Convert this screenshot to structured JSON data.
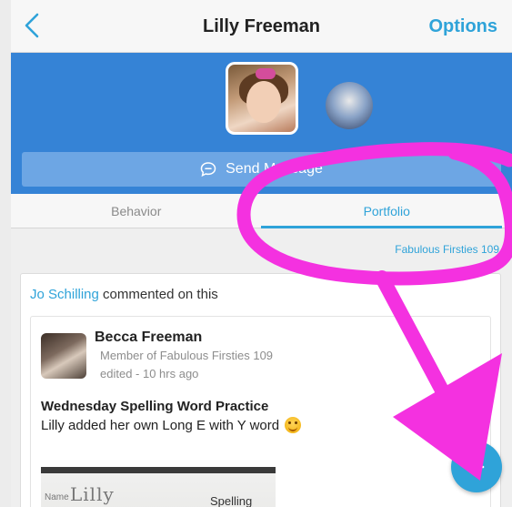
{
  "header": {
    "title": "Lilly Freeman",
    "options_label": "Options",
    "back_icon": "chevron-left-icon"
  },
  "profile": {
    "send_message_label": "Send Message"
  },
  "tabs": [
    {
      "label": "Behavior",
      "active": false
    },
    {
      "label": "Portfolio",
      "active": true
    }
  ],
  "class_filter": "Fabulous Firsties 109",
  "card": {
    "commenter": "Jo Schilling",
    "comment_text": " commented on this",
    "author_name": "Becca Freeman",
    "author_role": "Member of Fabulous Firsties 109",
    "author_time": "edited - 10 hrs ago",
    "post_title": "Wednesday Spelling Word Practice",
    "post_body": "Lilly added her own Long E with Y word",
    "worksheet": {
      "name_label": "Name",
      "name_value": "Lilly",
      "title": "Spelling Sort"
    }
  },
  "fab": {
    "icon": "plus-icon"
  },
  "colors": {
    "accent": "#2fa3d9",
    "band": "#3583d6",
    "annotation": "#f431e0"
  }
}
